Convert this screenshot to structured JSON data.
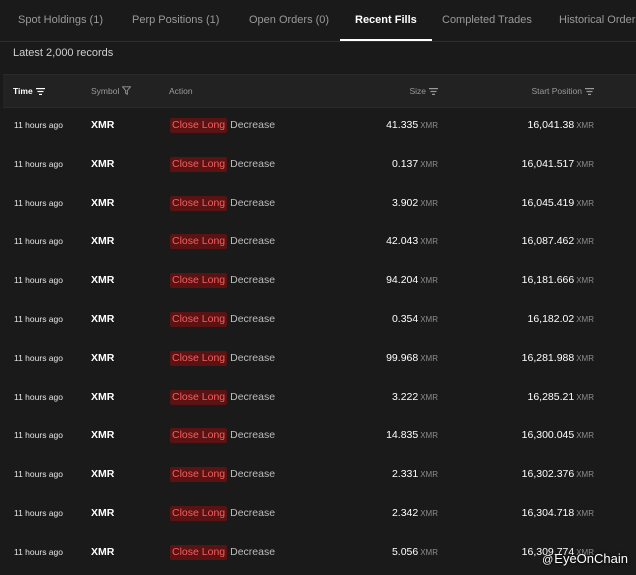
{
  "tabs": [
    {
      "label": "Spot Holdings (1)",
      "active": false
    },
    {
      "label": "Perp Positions (1)",
      "active": false
    },
    {
      "label": "Open Orders (0)",
      "active": false
    },
    {
      "label": "Recent Fills",
      "active": true
    },
    {
      "label": "Completed Trades",
      "active": false
    },
    {
      "label": "Historical Orders",
      "active": false
    }
  ],
  "records_label": "Latest 2,000 records",
  "columns": {
    "time": "Time",
    "symbol": "Symbol",
    "action": "Action",
    "size": "Size",
    "start_position": "Start Position"
  },
  "rows": [
    {
      "time": "11 hours ago",
      "symbol": "XMR",
      "action_tag": "Close Long",
      "action_dir": "Decrease",
      "size": "41.335",
      "size_unit": "XMR",
      "start": "16,041.38",
      "start_unit": "XMR"
    },
    {
      "time": "11 hours ago",
      "symbol": "XMR",
      "action_tag": "Close Long",
      "action_dir": "Decrease",
      "size": "0.137",
      "size_unit": "XMR",
      "start": "16,041.517",
      "start_unit": "XMR"
    },
    {
      "time": "11 hours ago",
      "symbol": "XMR",
      "action_tag": "Close Long",
      "action_dir": "Decrease",
      "size": "3.902",
      "size_unit": "XMR",
      "start": "16,045.419",
      "start_unit": "XMR"
    },
    {
      "time": "11 hours ago",
      "symbol": "XMR",
      "action_tag": "Close Long",
      "action_dir": "Decrease",
      "size": "42.043",
      "size_unit": "XMR",
      "start": "16,087.462",
      "start_unit": "XMR"
    },
    {
      "time": "11 hours ago",
      "symbol": "XMR",
      "action_tag": "Close Long",
      "action_dir": "Decrease",
      "size": "94.204",
      "size_unit": "XMR",
      "start": "16,181.666",
      "start_unit": "XMR"
    },
    {
      "time": "11 hours ago",
      "symbol": "XMR",
      "action_tag": "Close Long",
      "action_dir": "Decrease",
      "size": "0.354",
      "size_unit": "XMR",
      "start": "16,182.02",
      "start_unit": "XMR"
    },
    {
      "time": "11 hours ago",
      "symbol": "XMR",
      "action_tag": "Close Long",
      "action_dir": "Decrease",
      "size": "99.968",
      "size_unit": "XMR",
      "start": "16,281.988",
      "start_unit": "XMR"
    },
    {
      "time": "11 hours ago",
      "symbol": "XMR",
      "action_tag": "Close Long",
      "action_dir": "Decrease",
      "size": "3.222",
      "size_unit": "XMR",
      "start": "16,285.21",
      "start_unit": "XMR"
    },
    {
      "time": "11 hours ago",
      "symbol": "XMR",
      "action_tag": "Close Long",
      "action_dir": "Decrease",
      "size": "14.835",
      "size_unit": "XMR",
      "start": "16,300.045",
      "start_unit": "XMR"
    },
    {
      "time": "11 hours ago",
      "symbol": "XMR",
      "action_tag": "Close Long",
      "action_dir": "Decrease",
      "size": "2.331",
      "size_unit": "XMR",
      "start": "16,302.376",
      "start_unit": "XMR"
    },
    {
      "time": "11 hours ago",
      "symbol": "XMR",
      "action_tag": "Close Long",
      "action_dir": "Decrease",
      "size": "2.342",
      "size_unit": "XMR",
      "start": "16,304.718",
      "start_unit": "XMR"
    },
    {
      "time": "11 hours ago",
      "symbol": "XMR",
      "action_tag": "Close Long",
      "action_dir": "Decrease",
      "size": "5.056",
      "size_unit": "XMR",
      "start": "16,309.774",
      "start_unit": "XMR"
    }
  ],
  "watermark": {
    "at": "@",
    "text": "EyeOnChain"
  },
  "colors": {
    "background": "#1a1a1a",
    "header_background": "#222222",
    "close_long_badge_bg": "#5a1212",
    "close_long_badge_text": "#f26060",
    "active_tab": "#ffffff",
    "muted_text": "#9a9a9a"
  },
  "icons": {
    "sort": "sort-icon",
    "filter": "filter-icon"
  }
}
